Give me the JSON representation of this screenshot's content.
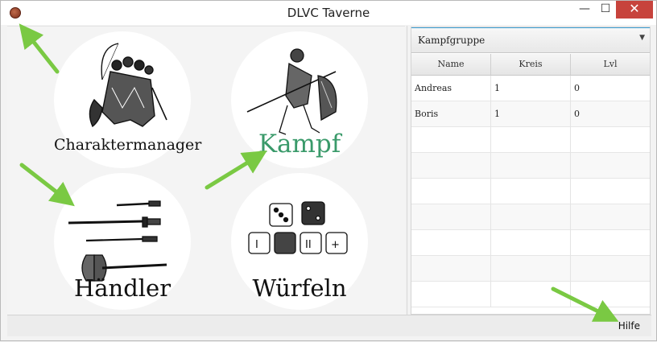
{
  "window": {
    "title": "DLVC Taverne",
    "min_label": "—",
    "max_label": "☐",
    "close_label": "✕"
  },
  "menu": {
    "items": [
      {
        "label": "Charaktermanager"
      },
      {
        "label": "Kampf"
      },
      {
        "label": "Händler"
      },
      {
        "label": "Würfeln"
      }
    ]
  },
  "group": {
    "selected": "Kampfgruppe",
    "columns": [
      "Name",
      "Kreis",
      "Lvl"
    ],
    "rows": [
      {
        "name": "Andreas",
        "kreis": "1",
        "lvl": "0"
      },
      {
        "name": "Boris",
        "kreis": "1",
        "lvl": "0"
      }
    ]
  },
  "status": {
    "help_label": "Hilfe"
  },
  "colors": {
    "kampf_accent": "#3a9a6a",
    "annotation_arrow": "#7ac943",
    "close_button": "#c7433c"
  }
}
